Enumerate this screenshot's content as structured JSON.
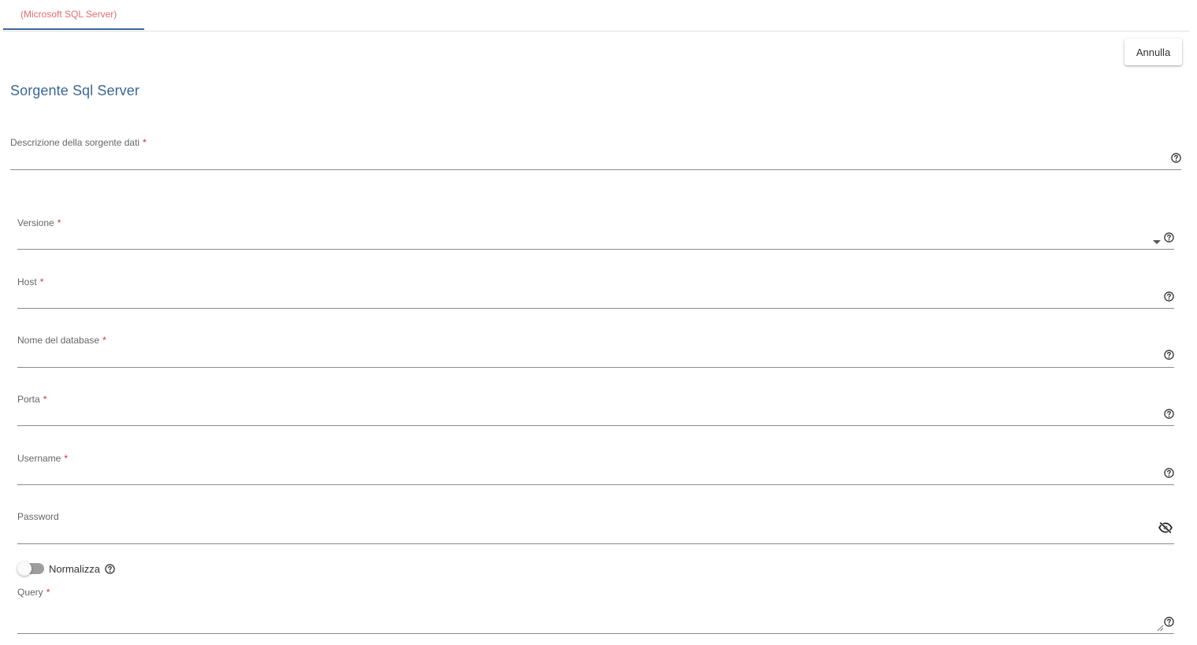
{
  "tabs": [
    {
      "label": "(Microsoft SQL Server)",
      "active": true
    }
  ],
  "toolbar": {
    "cancel_label": "Annulla"
  },
  "form": {
    "title": "Sorgente Sql Server",
    "required_marker": "*",
    "fields": {
      "description": {
        "label": "Descrizione della sorgente dati",
        "required": true,
        "value": ""
      },
      "version": {
        "label": "Versione",
        "required": true,
        "value": ""
      },
      "host": {
        "label": "Host",
        "required": true,
        "value": ""
      },
      "database": {
        "label": "Nome del database",
        "required": true,
        "value": ""
      },
      "port": {
        "label": "Porta",
        "required": true,
        "value": ""
      },
      "username": {
        "label": "Username",
        "required": true,
        "value": ""
      },
      "password": {
        "label": "Password",
        "required": false,
        "value": ""
      },
      "query": {
        "label": "Query",
        "required": true,
        "value": ""
      }
    },
    "normalize": {
      "label": "Normalizza",
      "enabled": false
    }
  },
  "colors": {
    "accent": "#3b6893",
    "tab_text": "#e46d6d",
    "required": "#d32f2f"
  },
  "icons": {
    "help": "help-circle-icon",
    "dropdown": "caret-down-icon",
    "password_visibility": "eye-off-icon",
    "resize": "resize-handle-icon"
  }
}
